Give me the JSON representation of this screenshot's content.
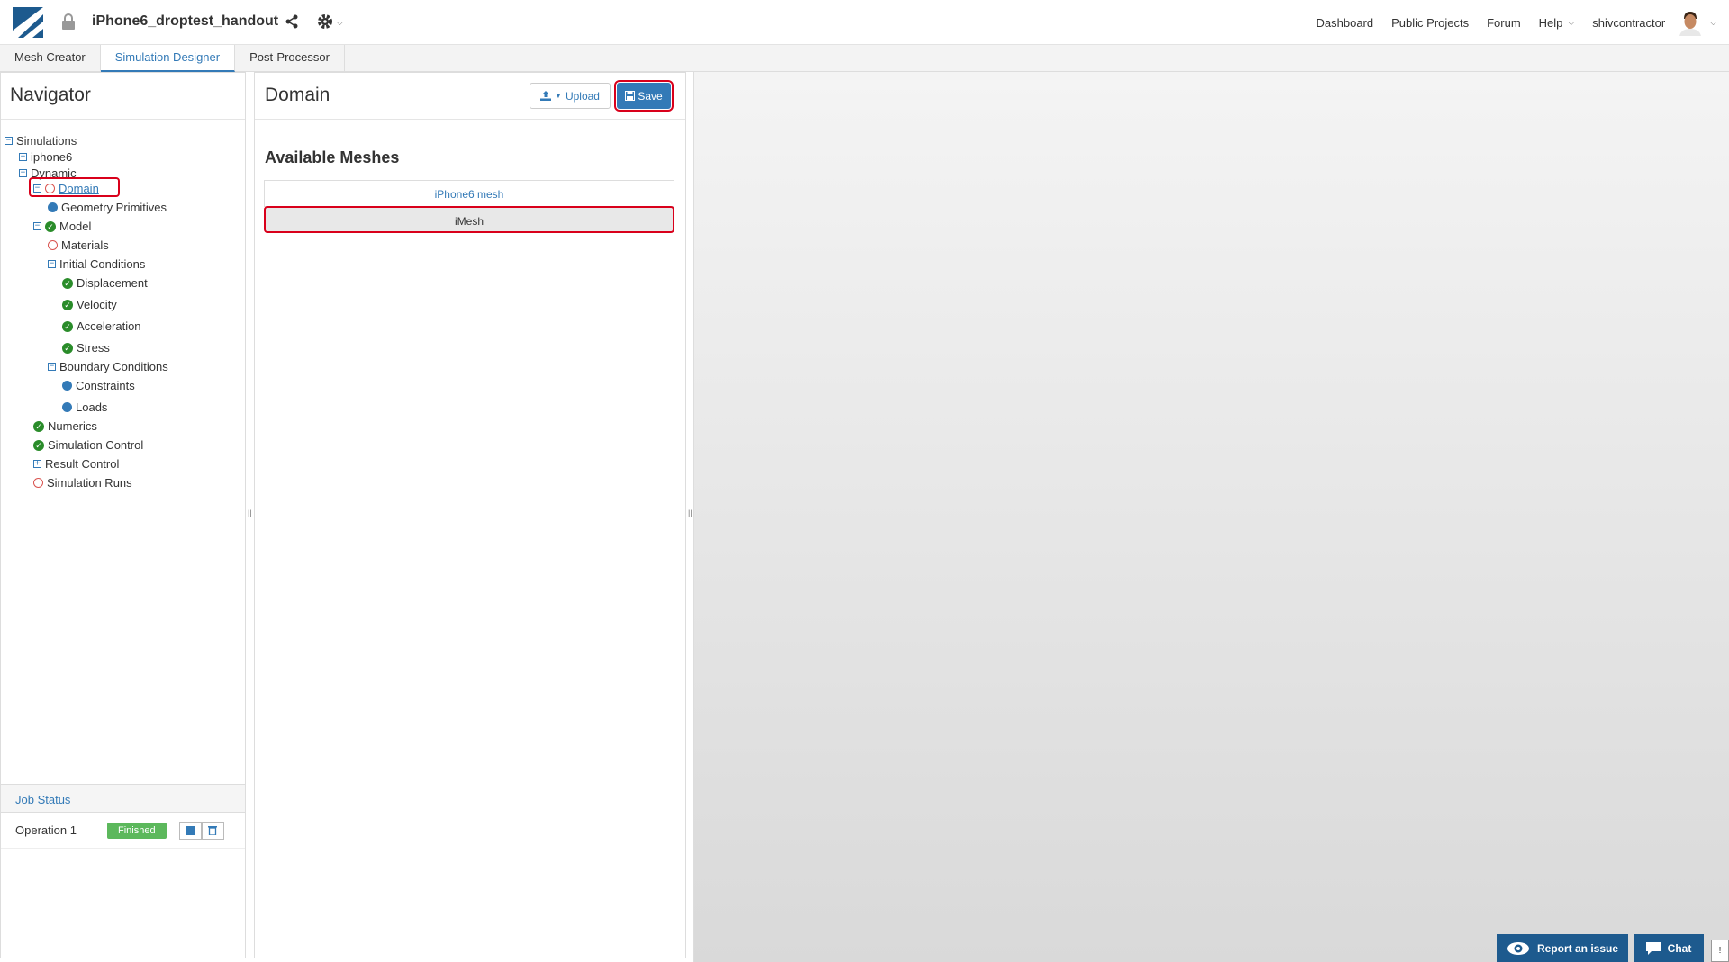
{
  "header": {
    "project_title": "iPhone6_droptest_handout",
    "nav": [
      "Dashboard",
      "Public Projects",
      "Forum",
      "Help"
    ],
    "username": "shivcontractor"
  },
  "tabs": [
    {
      "label": "Mesh Creator",
      "active": false
    },
    {
      "label": "Simulation Designer",
      "active": true
    },
    {
      "label": "Post-Processor",
      "active": false
    }
  ],
  "navigator": {
    "title": "Navigator",
    "tree": [
      {
        "label": "Simulations",
        "indent": 0,
        "marker": "collapse"
      },
      {
        "label": "iphone6",
        "indent": 1,
        "marker": "expand"
      },
      {
        "label": "Dynamic",
        "indent": 1,
        "marker": "collapse"
      },
      {
        "label": "Domain",
        "indent": 2,
        "marker": "collapse",
        "status": "incomplete",
        "selected": true
      },
      {
        "label": "Geometry Primitives",
        "indent": 3,
        "status": "neutral"
      },
      {
        "label": "Model",
        "indent": 2,
        "marker": "collapse",
        "status": "complete"
      },
      {
        "label": "Materials",
        "indent": 3,
        "status": "incomplete"
      },
      {
        "label": "Initial Conditions",
        "indent": 3,
        "marker": "collapse"
      },
      {
        "label": "Displacement",
        "indent": 4,
        "status": "complete"
      },
      {
        "label": "Velocity",
        "indent": 4,
        "status": "complete"
      },
      {
        "label": "Acceleration",
        "indent": 4,
        "status": "complete"
      },
      {
        "label": "Stress",
        "indent": 4,
        "status": "complete"
      },
      {
        "label": "Boundary Conditions",
        "indent": 3,
        "marker": "collapse"
      },
      {
        "label": "Constraints",
        "indent": 4,
        "status": "neutral"
      },
      {
        "label": "Loads",
        "indent": 4,
        "status": "neutral"
      },
      {
        "label": "Numerics",
        "indent": 2,
        "status": "complete"
      },
      {
        "label": "Simulation Control",
        "indent": 2,
        "status": "complete"
      },
      {
        "label": "Result Control",
        "indent": 2,
        "marker": "expand"
      },
      {
        "label": "Simulation Runs",
        "indent": 2,
        "status": "incomplete"
      }
    ]
  },
  "job_status": {
    "title": "Job Status",
    "operation": "Operation 1",
    "status": "Finished"
  },
  "domain": {
    "title": "Domain",
    "upload_label": "Upload",
    "save_label": "Save",
    "section_title": "Available Meshes",
    "meshes": [
      "iPhone6 mesh",
      "iMesh"
    ]
  },
  "footer": {
    "report_label": "Report an issue",
    "chat_label": "Chat"
  },
  "colors": {
    "accent": "#337ab7",
    "success": "#5cb85c",
    "highlight": "#d9001b",
    "incomplete": "#d9534f"
  }
}
